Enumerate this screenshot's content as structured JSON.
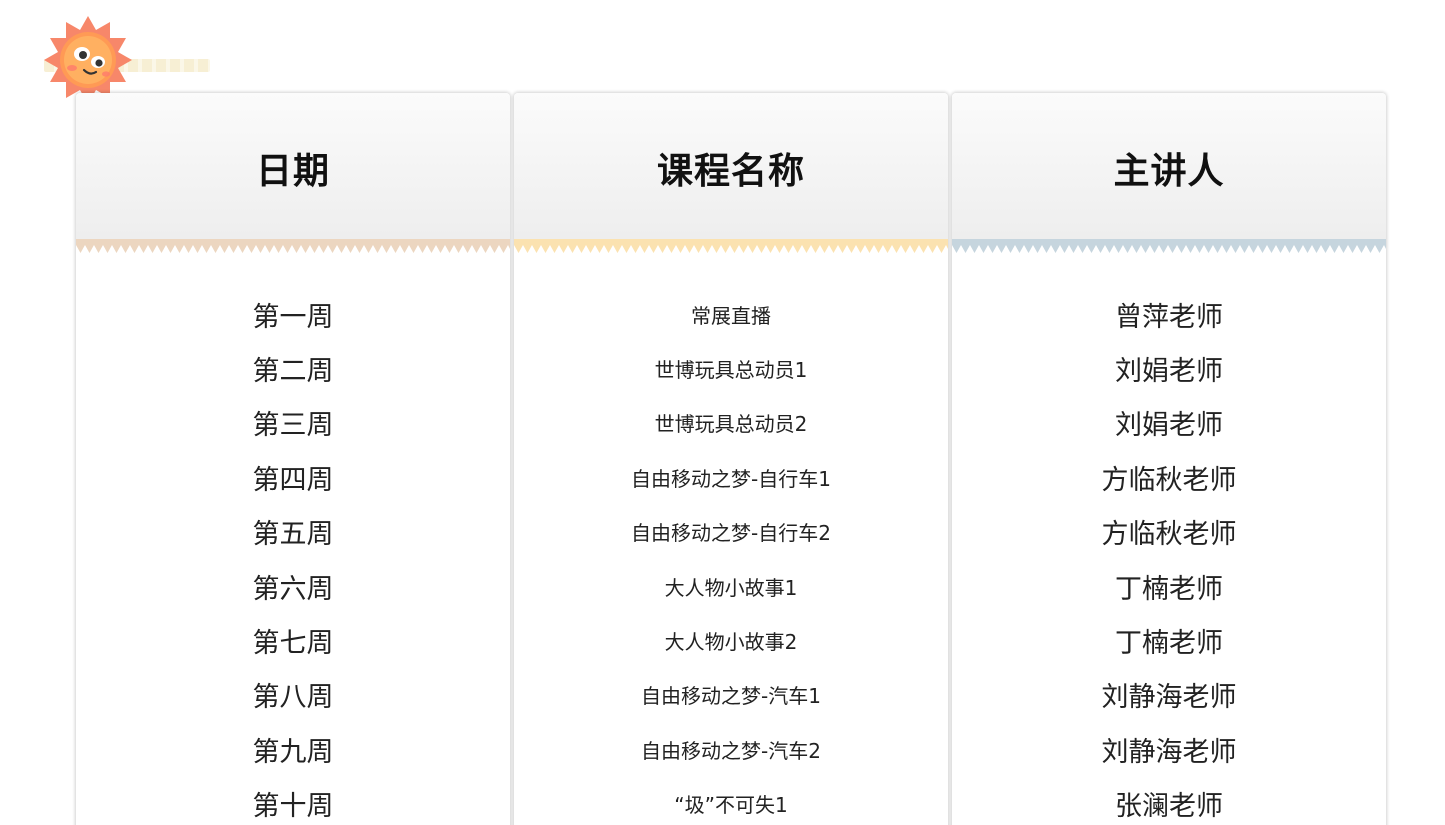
{
  "decor": {
    "sun_icon": "sun-face-icon",
    "colors": {
      "sun_outer": "#f7876a",
      "sun_inner": "#ffb061",
      "zigzag_date": "#ecd6c0",
      "zigzag_course": "#fbe2b0",
      "zigzag_teacher": "#c6d5de"
    }
  },
  "table": {
    "headers": {
      "date": "日期",
      "course": "课程名称",
      "teacher": "主讲人"
    },
    "rows": [
      {
        "date": "第一周",
        "course": "常展直播",
        "teacher": "曾萍老师"
      },
      {
        "date": "第二周",
        "course": "世博玩具总动员1",
        "teacher": "刘娟老师"
      },
      {
        "date": "第三周",
        "course": "世博玩具总动员2",
        "teacher": "刘娟老师"
      },
      {
        "date": "第四周",
        "course": "自由移动之梦-自行车1",
        "teacher": "方临秋老师"
      },
      {
        "date": "第五周",
        "course": "自由移动之梦-自行车2",
        "teacher": "方临秋老师"
      },
      {
        "date": "第六周",
        "course": "大人物小故事1",
        "teacher": "丁楠老师"
      },
      {
        "date": "第七周",
        "course": "大人物小故事2",
        "teacher": "丁楠老师"
      },
      {
        "date": "第八周",
        "course": "自由移动之梦-汽车1",
        "teacher": "刘静海老师"
      },
      {
        "date": "第九周",
        "course": "自由移动之梦-汽车2",
        "teacher": "刘静海老师"
      },
      {
        "date": "第十周",
        "course": "“圾”不可失1",
        "teacher": "张澜老师"
      }
    ]
  }
}
